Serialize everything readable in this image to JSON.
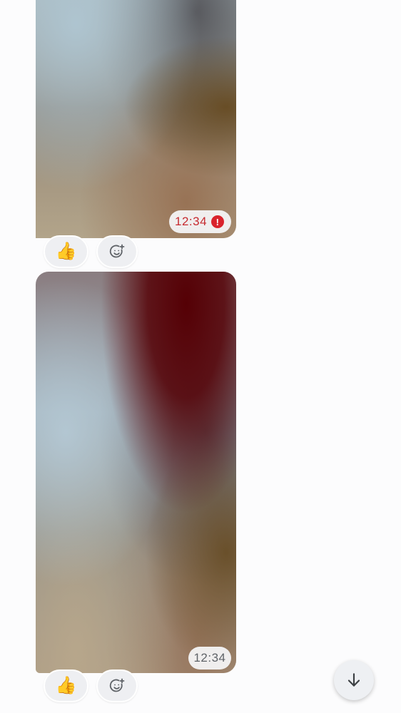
{
  "messages": [
    {
      "type": "image",
      "time": "12:34",
      "status": "error",
      "status_icon": "exclamation-icon",
      "reaction": "👍"
    },
    {
      "type": "image",
      "time": "12:34",
      "status": "sent",
      "reaction": "👍"
    }
  ],
  "colors": {
    "error": "#d9232c",
    "badge_bg": "#f4f4f6",
    "chip_bg": "#eeeff2",
    "fab_bg": "#eef0f3"
  },
  "error_glyph": "!",
  "icons": {
    "add_reaction": "add-reaction-icon",
    "scroll_down": "arrow-down-icon"
  }
}
